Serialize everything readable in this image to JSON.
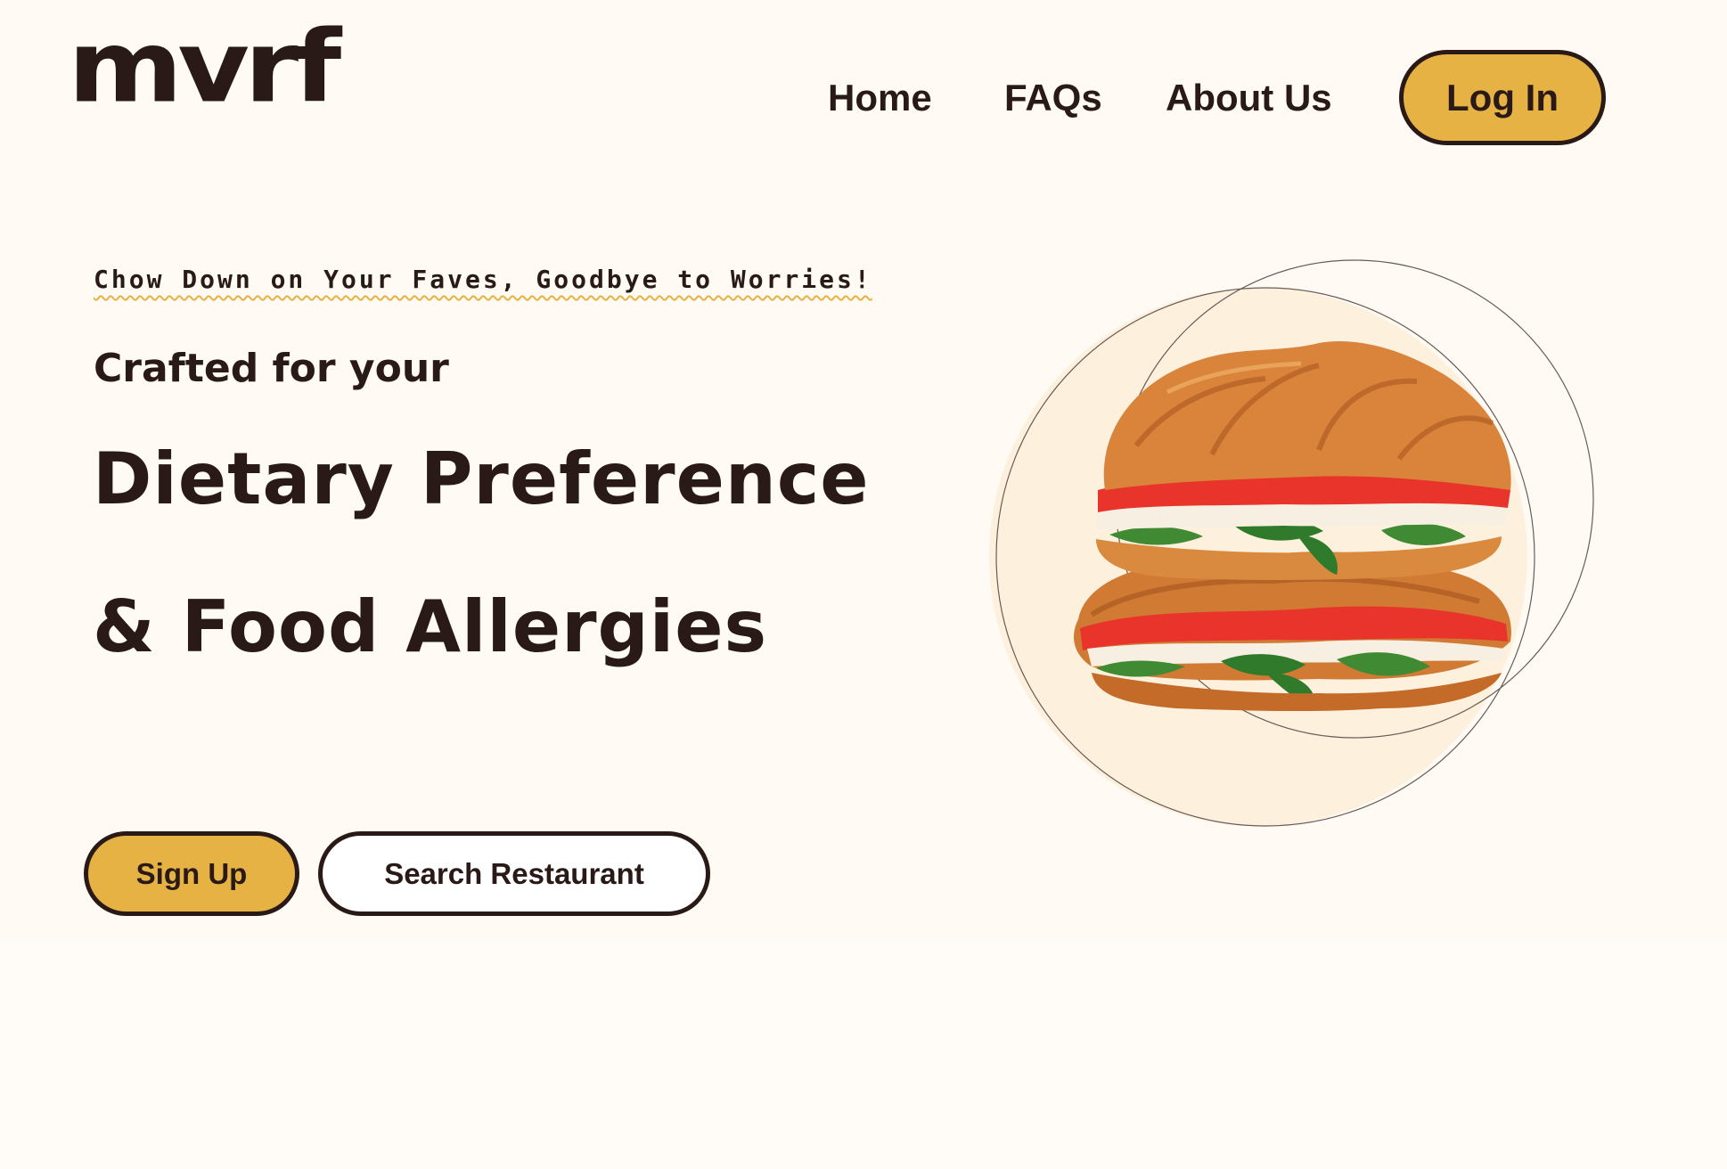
{
  "header": {
    "logo_text": "mvrf",
    "nav": {
      "home": "Home",
      "faqs": "FAQs",
      "about": "About Us"
    },
    "login_label": "Log In"
  },
  "hero": {
    "tagline": "Chow Down on Your Faves, Goodbye to Worries!",
    "subtitle": "Crafted for your",
    "headline_line1": "Dietary Preference",
    "headline_line2": "& Food Allergies",
    "buttons": {
      "signup": "Sign Up",
      "search": "Search Restaurant"
    },
    "illustration": "croissant-sandwich-image"
  },
  "colors": {
    "background": "#fffbf4",
    "accent": "#e6b244",
    "text": "#2a1a17",
    "circle_fill": "#fdf1dd"
  }
}
